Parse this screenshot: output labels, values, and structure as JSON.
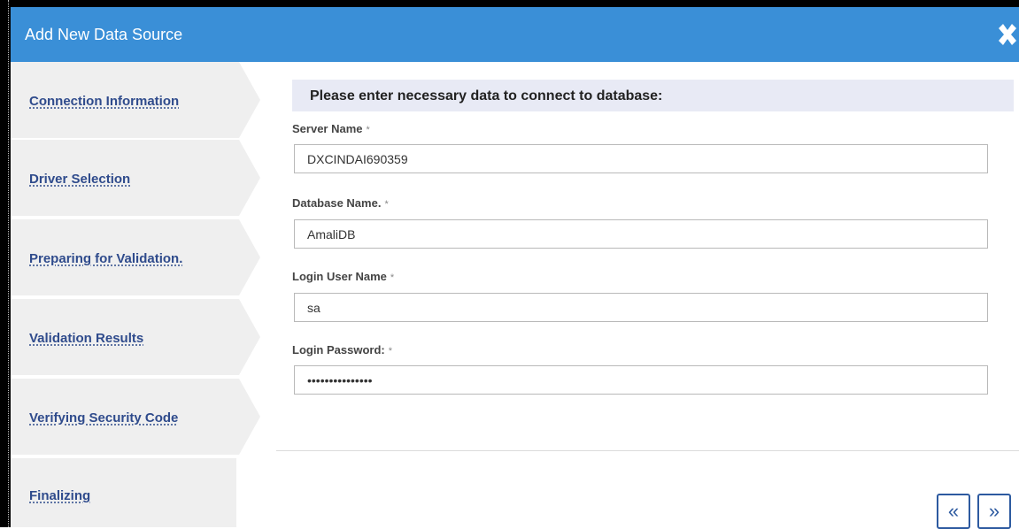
{
  "dialog": {
    "title": "Add New Data Source"
  },
  "steps": [
    {
      "label": "Connection Information"
    },
    {
      "label": "Driver Selection"
    },
    {
      "label": "Preparing for Validation."
    },
    {
      "label": "Validation Results"
    },
    {
      "label": "Verifying Security Code"
    },
    {
      "label": "Finalizing"
    }
  ],
  "form": {
    "header": "Please enter necessary data to connect to database:",
    "required_marker": "*",
    "server_name": {
      "label": "Server Name",
      "value": "DXCINDAI690359"
    },
    "database_name": {
      "label": "Database Name.",
      "value": "AmaliDB"
    },
    "login_user": {
      "label": "Login User Name",
      "value": "sa"
    },
    "login_password": {
      "label": "Login Password:",
      "value": "•••••••••••••••"
    }
  },
  "nav": {
    "back_glyph": "«",
    "next_glyph": "»"
  },
  "colors": {
    "titlebar": "#3a8fd7",
    "step_background": "#efefef",
    "step_link": "#2f4b8c",
    "header_band": "#e8eaf5",
    "nav_button": "#2d5aa0"
  }
}
